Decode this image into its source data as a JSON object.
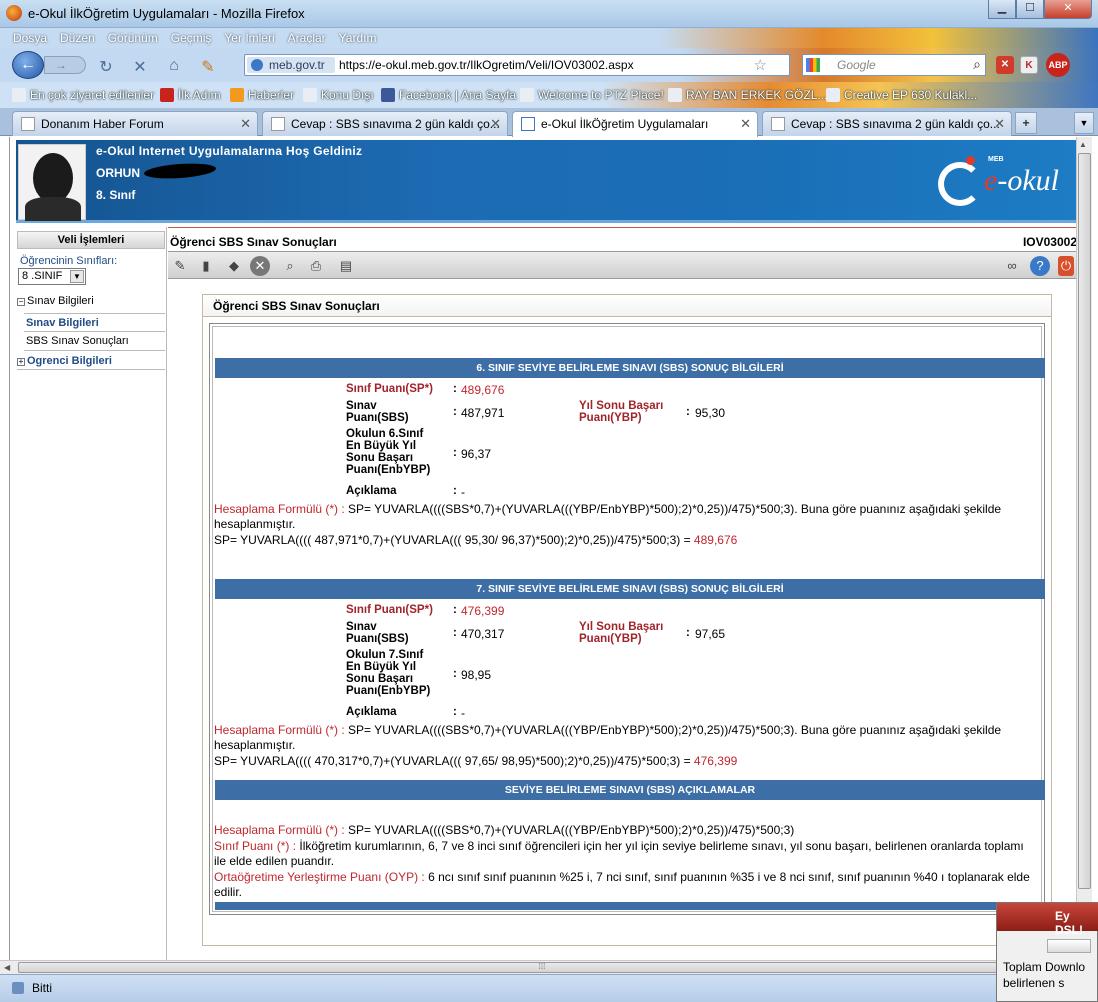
{
  "window": {
    "title": "e-Okul İlkÖğretim Uygulamaları - Mozilla Firefox",
    "btn_min": "▁",
    "btn_max": "☐",
    "btn_close": "✕"
  },
  "menu": [
    "Dosya",
    "Düzen",
    "Görünüm",
    "Geçmiş",
    "Yer İmleri",
    "Araçlar",
    "Yardım"
  ],
  "nav": {
    "site_badge": "meb.gov.tr",
    "url": "https://e-okul.meb.gov.tr/IlkOgretim/Veli/IOV03002.aspx",
    "search_placeholder": "Google"
  },
  "bookmarks": [
    "En çok ziyaret edilenler",
    "İlk Adım",
    "Haberler",
    "Konu Dışı",
    "Facebook | Ana Sayfa",
    "Welcome to PTZ Place!",
    "RAY-BAN ERKEK GÖZL...",
    "Creative EP 630 Kulakl..."
  ],
  "tabs": [
    {
      "label": "Donanım Haber Forum"
    },
    {
      "label": "Cevap : SBS sınavıma 2 gün kaldı ço..."
    },
    {
      "label": "e-Okul İlkÖğretim Uygulamaları"
    },
    {
      "label": "Cevap : SBS sınavıma 2 gün kaldı ço..."
    }
  ],
  "banner": {
    "welcome": "e-Okul Internet Uygulamalarına Hoş Geldiniz",
    "student_name": "ORHUN",
    "student_class": "8. Sınıf",
    "logo_meb": "MEB",
    "logo_e": "e",
    "logo_rest": "-okul"
  },
  "sidebar": {
    "header": "Veli İşlemleri",
    "class_label": "Öğrencinin Sınıfları:",
    "class_value": "8 .SINIF",
    "menu1": "Sınav Bilgileri",
    "sub1": "Sınav Bilgileri",
    "sub2": "SBS Sınav Sonuçları",
    "menu2": "Ogrenci Bilgileri"
  },
  "content": {
    "title": "Öğrenci SBS Sınav Sonuçları",
    "code": "IOV03002",
    "panel_title": "Öğrenci SBS Sınav Sonuçları"
  },
  "sec6": {
    "header": "6. SINIF SEVİYE BELİRLEME SINAVI (SBS) SONUÇ BİLGİLERİ",
    "sp_label": "Sınıf Puanı(SP*)",
    "sp_value": "489,676",
    "sbs_label_1": "Sınav",
    "sbs_label_2": "Puanı(SBS)",
    "sbs_value": "487,971",
    "ybp_label_1": "Yıl Sonu Başarı",
    "ybp_label_2": "Puanı(YBP)",
    "ybp_value": "95,30",
    "enb_label_1": "Okulun 6.Sınıf",
    "enb_label_2": "En Büyük Yıl",
    "enb_label_3": "Sonu Başarı",
    "enb_label_4": "Puanı(EnbYBP)",
    "enb_value": "96,37",
    "acik_label": "Açıklama",
    "acik_value": "-",
    "formula_label": "Hesaplama Formülü (*) :",
    "formula_text": " SP= YUVARLA((((SBS*0,7)+(YUVARLA(((YBP/EnbYBP)*500);2)*0,25))/475)*500;3). Buna göre puanınız aşağıdaki şekilde hesaplanmıştır.",
    "calc_text": "SP= YUVARLA(((( 487,971*0,7)+(YUVARLA((( 95,30/ 96,37)*500);2)*0,25))/475)*500;3) = ",
    "calc_result": "489,676"
  },
  "sec7": {
    "header": "7. SINIF SEVİYE BELİRLEME SINAVI (SBS) SONUÇ BİLGİLERİ",
    "sp_label": "Sınıf Puanı(SP*)",
    "sp_value": "476,399",
    "sbs_label_1": "Sınav",
    "sbs_label_2": "Puanı(SBS)",
    "sbs_value": "470,317",
    "ybp_label_1": "Yıl Sonu Başarı",
    "ybp_label_2": "Puanı(YBP)",
    "ybp_value": "97,65",
    "enb_label_1": "Okulun 7.Sınıf",
    "enb_label_2": "En Büyük Yıl",
    "enb_label_3": "Sonu Başarı",
    "enb_label_4": "Puanı(EnbYBP)",
    "enb_value": "98,95",
    "acik_label": "Açıklama",
    "acik_value": "-",
    "formula_label": "Hesaplama Formülü (*) :",
    "formula_text": " SP= YUVARLA((((SBS*0,7)+(YUVARLA(((YBP/EnbYBP)*500);2)*0,25))/475)*500;3). Buna göre puanınız aşağıdaki şekilde hesaplanmıştır.",
    "calc_text": "SP= YUVARLA(((( 470,317*0,7)+(YUVARLA((( 97,65/ 98,95)*500);2)*0,25))/475)*500;3) = ",
    "calc_result": "476,399"
  },
  "notes": {
    "header": "SEVİYE BELİRLEME SINAVI (SBS) AÇIKLAMALAR",
    "f_label": "Hesaplama Formülü (*) :",
    "f_text": " SP= YUVARLA((((SBS*0,7)+(YUVARLA(((YBP/EnbYBP)*500);2)*0,25))/475)*500;3)",
    "sp_label": "Sınıf Puanı (*) :",
    "sp_text": " İlköğretim kurumlarının, 6, 7 ve 8 inci sınıf öğrencileri için her yıl için seviye belirleme sınavı, yıl sonu başarı, belirlenen oranlarda toplamı ile elde edilen puandır.",
    "oyp_label": "Ortaöğretime Yerleştirme Puanı (OYP) :",
    "oyp_text": " 6 ncı sınıf sınıf puanının %25 i, 7 nci sınıf, sınıf puanının %35 i ve 8 nci sınıf, sınıf puanının %40 ı toplanarak elde edilir."
  },
  "status": {
    "text": "Bitti"
  },
  "popup": {
    "title": "Ey DSL!",
    "body1": "Toplam Downlo",
    "body2": "belirlenen s"
  },
  "colors": {
    "section_bar": "#3d6fa6",
    "label_red": "#a0242a",
    "value_red": "#c0272d",
    "banner_blue": "#1d6bb3"
  }
}
